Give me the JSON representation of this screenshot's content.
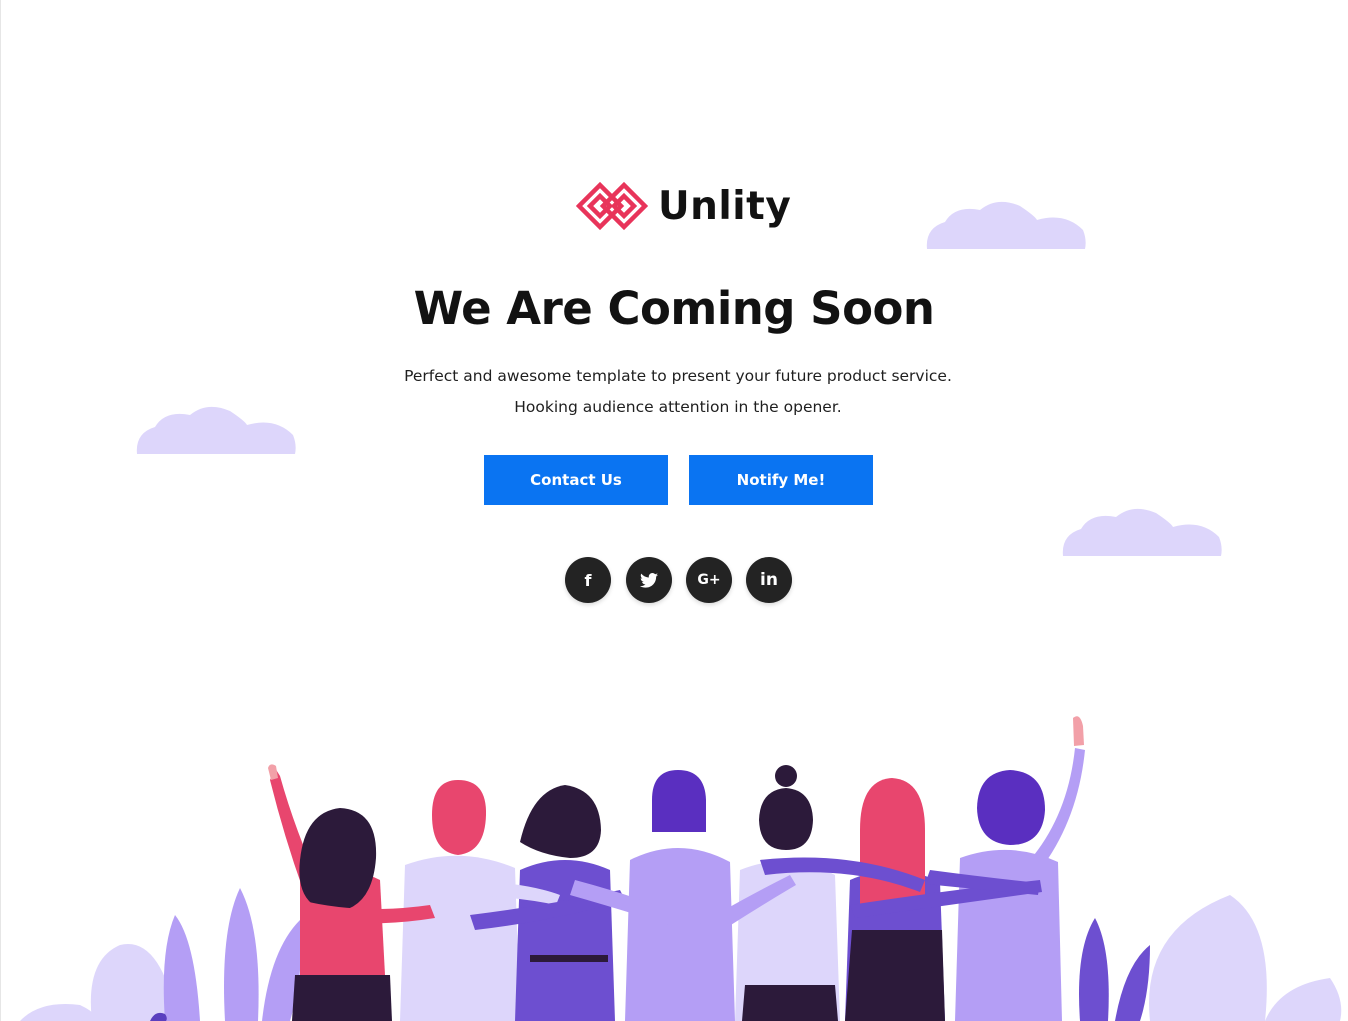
{
  "brand": {
    "name": "Unlity",
    "logo_color": "#e8345a"
  },
  "hero": {
    "title": "We Are Coming Soon",
    "subtitle_line1": "Perfect and awesome template to present your future product service.",
    "subtitle_line2": "Hooking audience attention in the opener."
  },
  "buttons": {
    "contact_label": "Contact Us",
    "notify_label": "Notify Me!",
    "color": "#0a74f2"
  },
  "social": [
    {
      "icon": "facebook-icon",
      "glyph": "f"
    },
    {
      "icon": "twitter-icon",
      "glyph": ""
    },
    {
      "icon": "google-plus-icon",
      "glyph": "G+"
    },
    {
      "icon": "linkedin-icon",
      "glyph": "in"
    }
  ],
  "colors": {
    "cloud": "#ddd6fb",
    "purple": "#6d4fd0",
    "pink": "#e8466e",
    "dark": "#2c1a3a"
  }
}
